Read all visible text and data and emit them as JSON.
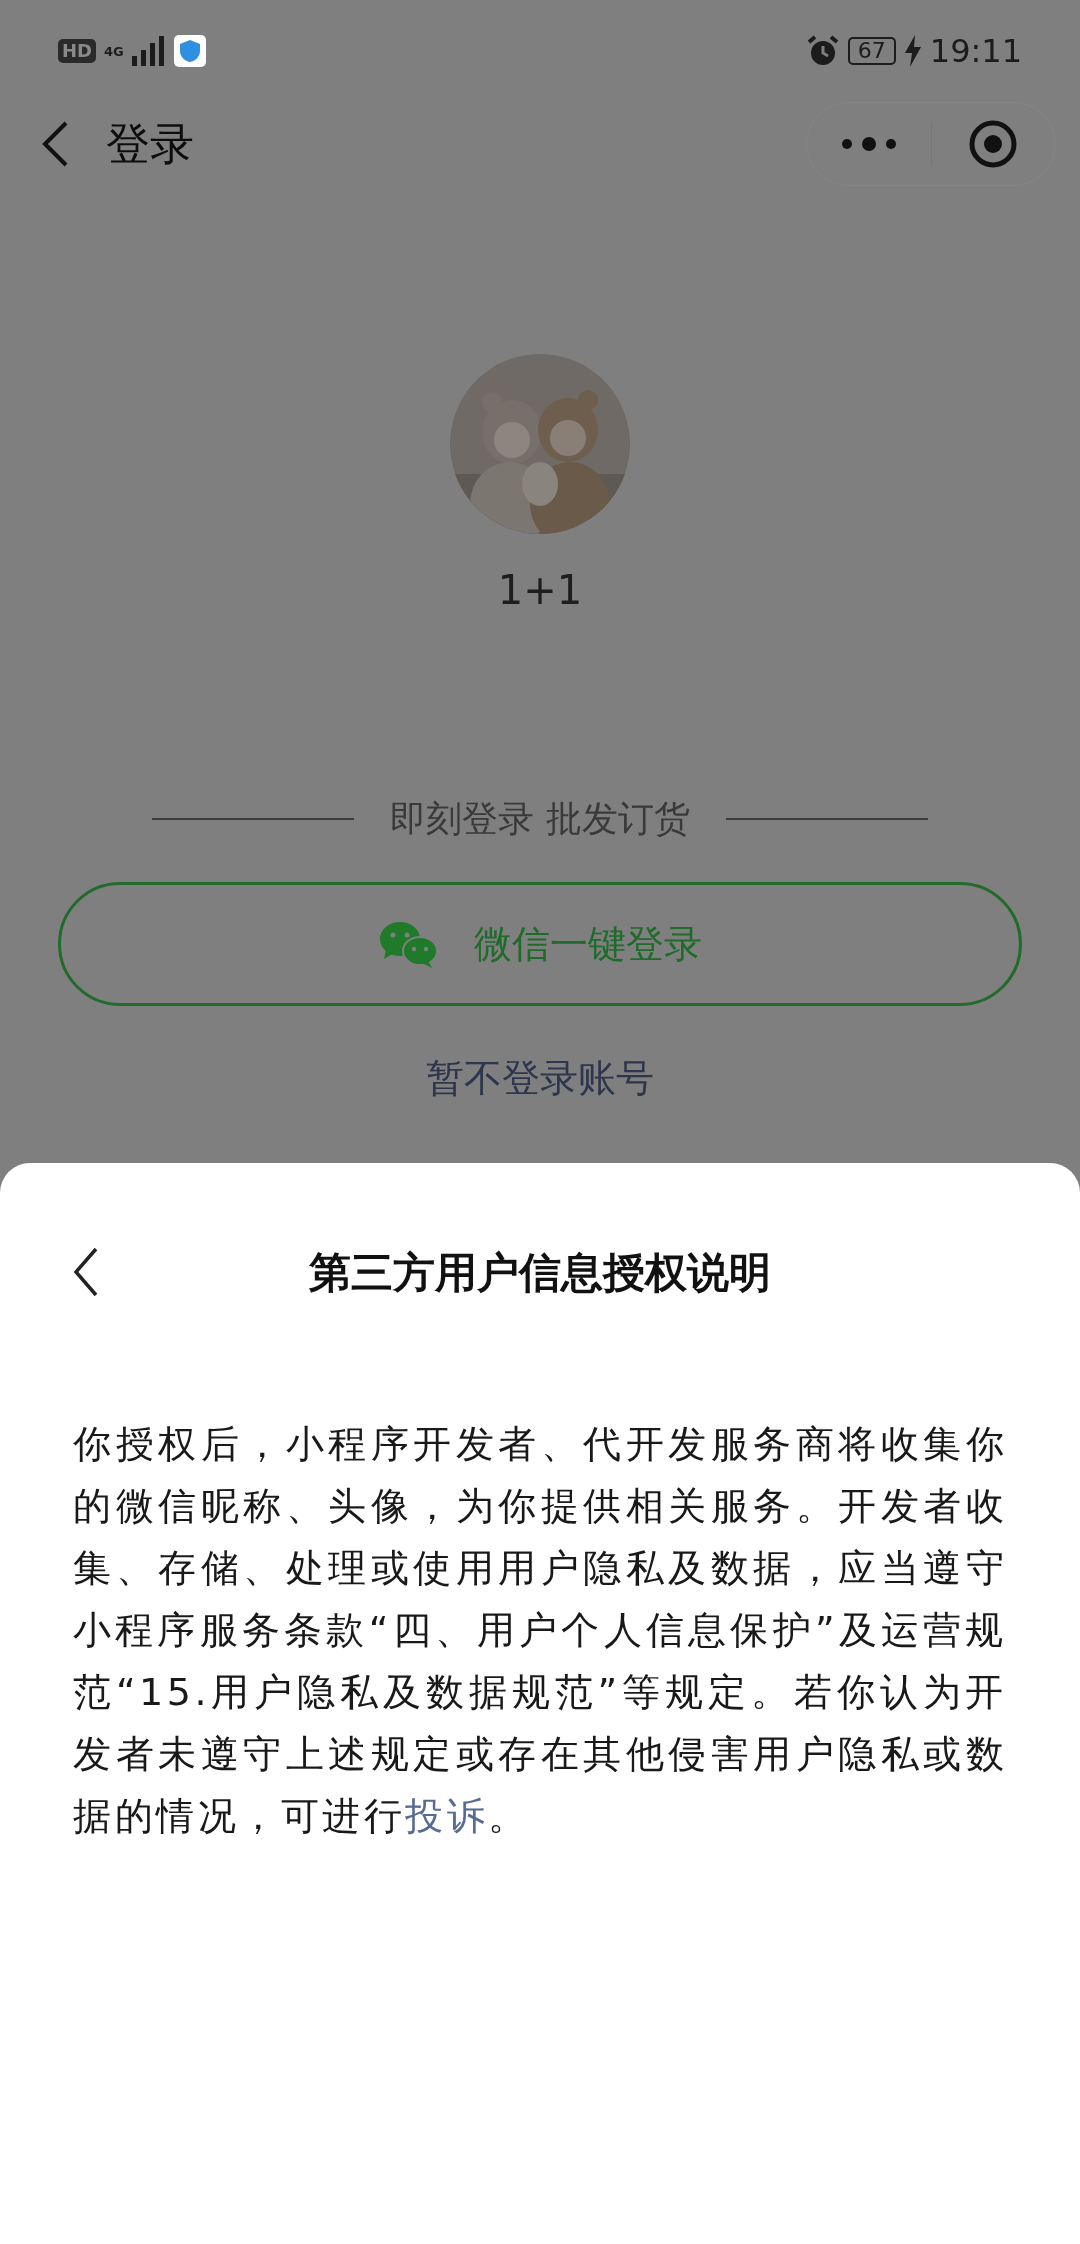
{
  "status_bar": {
    "hd": "HD",
    "network": "4G",
    "battery": "67",
    "charging": true,
    "time": "19:11"
  },
  "nav": {
    "title": "登录"
  },
  "profile": {
    "name": "1+1"
  },
  "login": {
    "divider_text": "即刻登录 批发订货",
    "wechat_button": "微信一键登录",
    "skip_link": "暂不登录账号"
  },
  "sheet": {
    "title": "第三方用户信息授权说明",
    "description": {
      "before": "你授权后，小程序开发者、代开发服务商将收集你的微信昵称、头像，为你提供相关服务。开发者收集、存储、处理或使用用户隐私及数据，应当遵守小程序服务条款“四、用户个人信息保护”及运营规范“15.用户隐私及数据规范”等规定。若你认为开发者未遵守上述规定或存在其他侵害用户隐私或数据的情况，可进行",
      "link": "投诉",
      "after": "。"
    }
  }
}
